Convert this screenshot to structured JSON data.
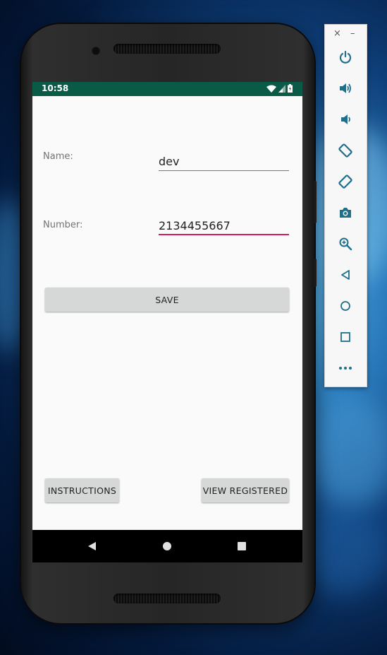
{
  "status_bar": {
    "time": "10:58"
  },
  "form": {
    "name_label": "Name:",
    "name_value": "dev",
    "number_label": "Number:",
    "number_value": "2134455667"
  },
  "buttons": {
    "save": "SAVE",
    "instructions": "INSTRUCTIONS",
    "view_registered": "VIEW REGISTERED"
  },
  "emulator_toolbar": {
    "close": "×",
    "minimize": "–",
    "items": [
      "power-icon",
      "volume-up-icon",
      "volume-down-icon",
      "rotate-left-icon",
      "rotate-right-icon",
      "camera-icon",
      "zoom-icon",
      "back-icon",
      "home-icon",
      "overview-icon",
      "more-icon"
    ]
  },
  "colors": {
    "status_bar": "#0a5a48",
    "accent": "#d81b60",
    "button_bg": "#d6d7d7",
    "toolbar_icon": "#1f6f8b"
  }
}
